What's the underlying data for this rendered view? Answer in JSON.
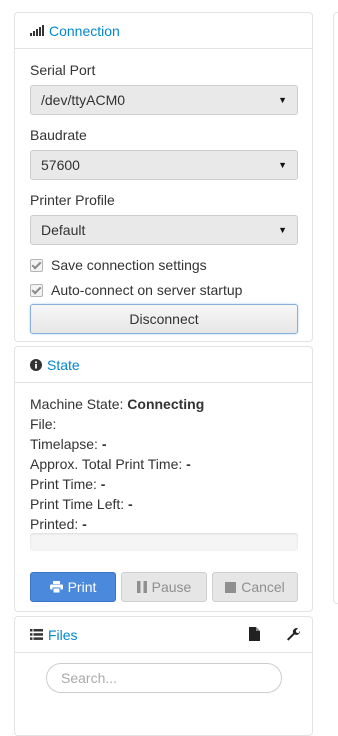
{
  "connection": {
    "title": "Connection",
    "icon": "signal-icon",
    "serial_port_label": "Serial Port",
    "serial_port_value": "/dev/ttyACM0",
    "baudrate_label": "Baudrate",
    "baudrate_value": "57600",
    "printer_profile_label": "Printer Profile",
    "printer_profile_value": "Default",
    "save_settings_label": "Save connection settings",
    "save_settings_checked": true,
    "autoconnect_label": "Auto-connect on server startup",
    "autoconnect_checked": true,
    "disconnect_label": "Disconnect"
  },
  "state": {
    "title": "State",
    "icon": "info-circle-icon",
    "machine_state_label": "Machine State:",
    "machine_state_value": "Connecting",
    "file_label": "File:",
    "file_value": "",
    "timelapse_label": "Timelapse:",
    "timelapse_value": "-",
    "approx_total_label": "Approx. Total Print Time:",
    "approx_total_value": "-",
    "print_time_label": "Print Time:",
    "print_time_value": "-",
    "print_time_left_label": "Print Time Left:",
    "print_time_left_value": "-",
    "printed_label": "Printed:",
    "printed_value": "-",
    "progress": 0,
    "print_label": "Print",
    "pause_label": "Pause",
    "cancel_label": "Cancel"
  },
  "files": {
    "title": "Files",
    "icon": "list-icon",
    "search_placeholder": "Search..."
  },
  "colors": {
    "accent": "#0088cc",
    "primary_button": "#4a89dc"
  }
}
